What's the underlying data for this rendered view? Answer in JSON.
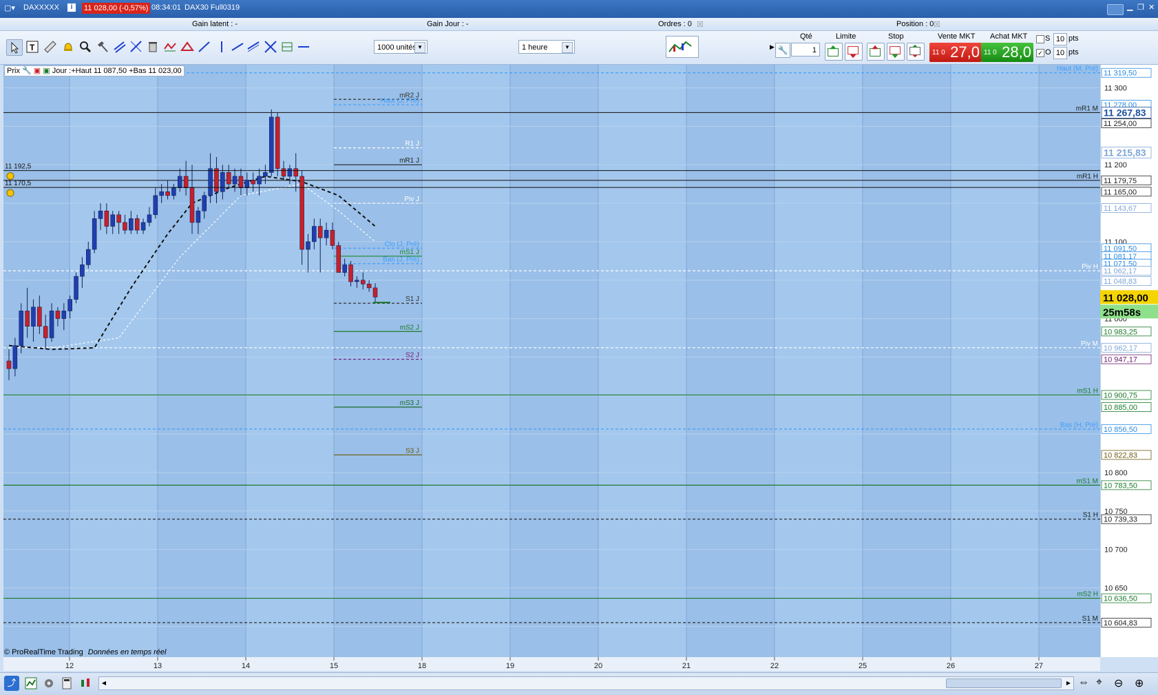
{
  "window": {
    "symbol": "DAXXXXX",
    "price_badge": "11 028,00 (-0,57%)",
    "time": "08:34:01",
    "instrument": "DAX30 Full0319"
  },
  "infobar": {
    "gain_latent": "Gain latent :  -",
    "gain_jour": "Gain Jour :  -",
    "ordres": "Ordres :  0",
    "position": "Position :  0"
  },
  "toolbar": {
    "quantity_select": "1000 unités",
    "timeframe_select": "1 heure",
    "qty_label": "Qté",
    "qty_value": "1",
    "limite_label": "Limite",
    "stop_label": "Stop",
    "vente_label": "Vente MKT",
    "achat_label": "Achat MKT",
    "vente_small": "11 0",
    "vente_big": "27,0",
    "achat_small": "11 0",
    "achat_big": "28,0",
    "s_label": "S",
    "o_label": "O",
    "pts_value_1": "10",
    "pts_value_2": "10",
    "pts_label_1": "pts",
    "pts_label_2": "pts"
  },
  "chart_header": {
    "prix_label": "Prix",
    "day_info": "Jour :+Haut 11 087,50 +Bas 11 023,00"
  },
  "footer": {
    "copyright": "© ProRealTime Trading",
    "data_label": "Données en temps réel"
  },
  "colors": {
    "chart_bg": "#9fc3ea",
    "bull": "#1f3fb0",
    "bear": "#c8202a",
    "last_price": "#f5d400",
    "timer": "#8fe08a"
  },
  "chart_data": {
    "type": "candlestick",
    "timeframe": "1 heure",
    "ylim": [
      10560,
      11330
    ],
    "x_ticks": [
      "12",
      "13",
      "14",
      "15",
      "18",
      "19",
      "20",
      "21",
      "22",
      "25",
      "26",
      "27"
    ],
    "y_ticks": [
      "11 300",
      "11 200",
      "11 100",
      "11 000",
      "10 900",
      "10 800",
      "10 750",
      "10 700",
      "10 650"
    ],
    "last_price": "11 028,00",
    "timer": "25m58s",
    "alerts": [
      "11 192,5",
      "11 170,5"
    ],
    "axis_labels": [
      {
        "text": "11 319,50",
        "v": 11319.5,
        "c": "#2a8be0"
      },
      {
        "text": "11 278,00",
        "v": 11278,
        "c": "#2a8be0"
      },
      {
        "text": "11 267,83",
        "v": 11267.83,
        "c": "#1b4f9e",
        "big": true
      },
      {
        "text": "11 254,00",
        "v": 11254,
        "c": "#222"
      },
      {
        "text": "11 215,83",
        "v": 11215.83,
        "c": "#7fa6d6",
        "big": true
      },
      {
        "text": "11 179,75",
        "v": 11179.75,
        "c": "#222"
      },
      {
        "text": "11 165,00",
        "v": 11165,
        "c": "#222"
      },
      {
        "text": "11 143,67",
        "v": 11143.67,
        "c": "#7fa6d6"
      },
      {
        "text": "11 091,50",
        "v": 11091.5,
        "c": "#2a8be0"
      },
      {
        "text": "11 081,17",
        "v": 11081.17,
        "c": "#2a8be0"
      },
      {
        "text": "11 071,50",
        "v": 11071.5,
        "c": "#2a8be0"
      },
      {
        "text": "11 062,17",
        "v": 11062.17,
        "c": "#7fa6d6"
      },
      {
        "text": "11 048,83",
        "v": 11048.83,
        "c": "#7fa6d6"
      },
      {
        "text": "10 983,25",
        "v": 10983.25,
        "c": "#1a7a2a"
      },
      {
        "text": "10 962,17",
        "v": 10962.17,
        "c": "#7fa6d6"
      },
      {
        "text": "10 947,17",
        "v": 10947.17,
        "c": "#6a1a6a"
      },
      {
        "text": "10 900,75",
        "v": 10900.75,
        "c": "#1a7a2a"
      },
      {
        "text": "10 885,00",
        "v": 10885,
        "c": "#1a7a2a"
      },
      {
        "text": "10 856,50",
        "v": 10856.5,
        "c": "#2a8be0"
      },
      {
        "text": "10 822,83",
        "v": 10822.83,
        "c": "#6a5a10"
      },
      {
        "text": "10 783,50",
        "v": 10783.5,
        "c": "#1a7a2a"
      },
      {
        "text": "10 739,33",
        "v": 10739.33,
        "c": "#222"
      },
      {
        "text": "10 636,50",
        "v": 10636.5,
        "c": "#1a7a2a"
      },
      {
        "text": "10 604,83",
        "v": 10604.83,
        "c": "#222"
      }
    ],
    "levels": [
      {
        "name": "Haut (M, Pré)",
        "v": 11319.5,
        "scope": "full",
        "color": "#3ea0ff",
        "dash": true
      },
      {
        "name": "mR2 J",
        "v": 11285,
        "scope": "day",
        "color": "#333",
        "dash": true
      },
      {
        "name": "Haut (J, Pré)",
        "v": 11278,
        "scope": "day",
        "color": "#3ea0ff",
        "dash": true
      },
      {
        "name": "mR1 M",
        "v": 11267.83,
        "scope": "full",
        "color": "#222",
        "dash": false
      },
      {
        "name": "R1 J",
        "v": 11222,
        "scope": "day",
        "color": "#ffffff",
        "dash": true
      },
      {
        "name": "mR1 J",
        "v": 11200,
        "scope": "day",
        "color": "#222",
        "dash": false
      },
      {
        "name": "mR1 H",
        "v": 11179.75,
        "scope": "full",
        "color": "#222",
        "dash": false
      },
      {
        "name": "Piv J",
        "v": 11150,
        "scope": "day",
        "color": "#ffffff",
        "dash": true
      },
      {
        "name": "Clo (J, Pré)",
        "v": 11091.5,
        "scope": "day",
        "color": "#3ea0ff",
        "dash": true
      },
      {
        "name": "mS1 J",
        "v": 11081.17,
        "scope": "day",
        "color": "#1a8a2a",
        "dash": false
      },
      {
        "name": "Bas (J, Pré)",
        "v": 11071.5,
        "scope": "day",
        "color": "#3ea0ff",
        "dash": true
      },
      {
        "name": "Piv H",
        "v": 11062.17,
        "scope": "full",
        "color": "#ffffff",
        "dash": true
      },
      {
        "name": "S1 J",
        "v": 11020,
        "scope": "day",
        "color": "#333",
        "dash": true
      },
      {
        "name": "mS2 J",
        "v": 10983.25,
        "scope": "day",
        "color": "#1a7a2a",
        "dash": false
      },
      {
        "name": "Piv M",
        "v": 10962.17,
        "scope": "full",
        "color": "#ffffff",
        "dash": true
      },
      {
        "name": "S2 J",
        "v": 10947.17,
        "scope": "day",
        "color": "#7a1a7a",
        "dash": true
      },
      {
        "name": "mS1 H",
        "v": 10900.75,
        "scope": "full",
        "color": "#1a7a2a",
        "dash": false
      },
      {
        "name": "mS3 J",
        "v": 10885,
        "scope": "day",
        "color": "#1a6a2a",
        "dash": false
      },
      {
        "name": "Bas (H, Pré)",
        "v": 10856.5,
        "scope": "full",
        "color": "#3ea0ff",
        "dash": true
      },
      {
        "name": "S3 J",
        "v": 10822.83,
        "scope": "day",
        "color": "#6a5a10",
        "dash": false
      },
      {
        "name": "mS1 M",
        "v": 10783.5,
        "scope": "full",
        "color": "#1a7a2a",
        "dash": false
      },
      {
        "name": "S1 H",
        "v": 10739.33,
        "scope": "full",
        "color": "#222",
        "dash": true
      },
      {
        "name": "mS2 H",
        "v": 10636.5,
        "scope": "full",
        "color": "#1a7a2a",
        "dash": false
      },
      {
        "name": "S1 M",
        "v": 10604.83,
        "scope": "full",
        "color": "#222",
        "dash": true
      }
    ],
    "candles": [
      [
        10945,
        10960,
        10920,
        10935
      ],
      [
        10935,
        10975,
        10925,
        10965
      ],
      [
        10965,
        11020,
        10955,
        11010
      ],
      [
        11010,
        11040,
        10975,
        10990
      ],
      [
        10990,
        11025,
        10970,
        11015
      ],
      [
        11015,
        11030,
        10980,
        10990
      ],
      [
        10990,
        11005,
        10960,
        10975
      ],
      [
        10975,
        11020,
        10970,
        11010
      ],
      [
        11010,
        11015,
        10990,
        11000
      ],
      [
        11000,
        11020,
        10985,
        11010
      ],
      [
        11010,
        11030,
        11000,
        11025
      ],
      [
        11025,
        11060,
        11020,
        11055
      ],
      [
        11055,
        11080,
        11040,
        11070
      ],
      [
        11070,
        11100,
        11065,
        11090
      ],
      [
        11090,
        11140,
        11085,
        11130
      ],
      [
        11130,
        11150,
        11115,
        11140
      ],
      [
        11140,
        11150,
        11110,
        11120
      ],
      [
        11120,
        11140,
        11110,
        11135
      ],
      [
        11135,
        11140,
        11110,
        11125
      ],
      [
        11125,
        11135,
        11110,
        11115
      ],
      [
        11115,
        11140,
        11110,
        11130
      ],
      [
        11130,
        11135,
        11110,
        11115
      ],
      [
        11115,
        11130,
        11110,
        11125
      ],
      [
        11125,
        11145,
        11120,
        11135
      ],
      [
        11135,
        11170,
        11130,
        11160
      ],
      [
        11160,
        11175,
        11150,
        11165
      ],
      [
        11165,
        11180,
        11155,
        11160
      ],
      [
        11160,
        11175,
        11155,
        11170
      ],
      [
        11170,
        11195,
        11165,
        11185
      ],
      [
        11185,
        11205,
        11160,
        11170
      ],
      [
        11170,
        11200,
        11110,
        11125
      ],
      [
        11125,
        11145,
        11110,
        11140
      ],
      [
        11140,
        11165,
        11130,
        11160
      ],
      [
        11160,
        11215,
        11150,
        11195
      ],
      [
        11195,
        11210,
        11150,
        11165
      ],
      [
        11165,
        11200,
        11155,
        11190
      ],
      [
        11190,
        11200,
        11170,
        11175
      ],
      [
        11175,
        11195,
        11165,
        11185
      ],
      [
        11185,
        11195,
        11160,
        11170
      ],
      [
        11170,
        11190,
        11160,
        11180
      ],
      [
        11180,
        11190,
        11165,
        11175
      ],
      [
        11175,
        11195,
        11160,
        11185
      ],
      [
        11185,
        11200,
        11175,
        11190
      ],
      [
        11190,
        11272,
        11185,
        11262
      ],
      [
        11262,
        11268,
        11185,
        11195
      ],
      [
        11195,
        11205,
        11180,
        11185
      ],
      [
        11185,
        11200,
        11175,
        11195
      ],
      [
        11195,
        11215,
        11165,
        11185
      ],
      [
        11185,
        11192,
        11070,
        11090
      ],
      [
        11090,
        11110,
        11060,
        11100
      ],
      [
        11100,
        11130,
        11090,
        11120
      ],
      [
        11120,
        11130,
        11060,
        11105
      ],
      [
        11105,
        11125,
        11095,
        11115
      ],
      [
        11115,
        11125,
        11090,
        11095
      ],
      [
        11095,
        11100,
        11065,
        11060
      ],
      [
        11060,
        11078,
        11055,
        11070
      ],
      [
        11070,
        11075,
        11042,
        11048
      ],
      [
        11048,
        11055,
        11040,
        11050
      ],
      [
        11050,
        11060,
        11038,
        11045
      ],
      [
        11045,
        11050,
        11035,
        11040
      ],
      [
        11040,
        11046,
        11020,
        11028
      ]
    ],
    "ma_fast": [
      [
        0,
        10962
      ],
      [
        8,
        10963
      ],
      [
        18,
        10975
      ],
      [
        28,
        11080
      ],
      [
        38,
        11160
      ],
      [
        48,
        11175
      ],
      [
        54,
        11140
      ],
      [
        60,
        11100
      ]
    ],
    "ma_slow": [
      [
        0,
        10965
      ],
      [
        7,
        10960
      ],
      [
        14,
        10962
      ],
      [
        20,
        11040
      ],
      [
        26,
        11110
      ],
      [
        30,
        11150
      ],
      [
        36,
        11170
      ],
      [
        42,
        11185
      ],
      [
        48,
        11178
      ],
      [
        54,
        11160
      ],
      [
        60,
        11120
      ]
    ]
  }
}
